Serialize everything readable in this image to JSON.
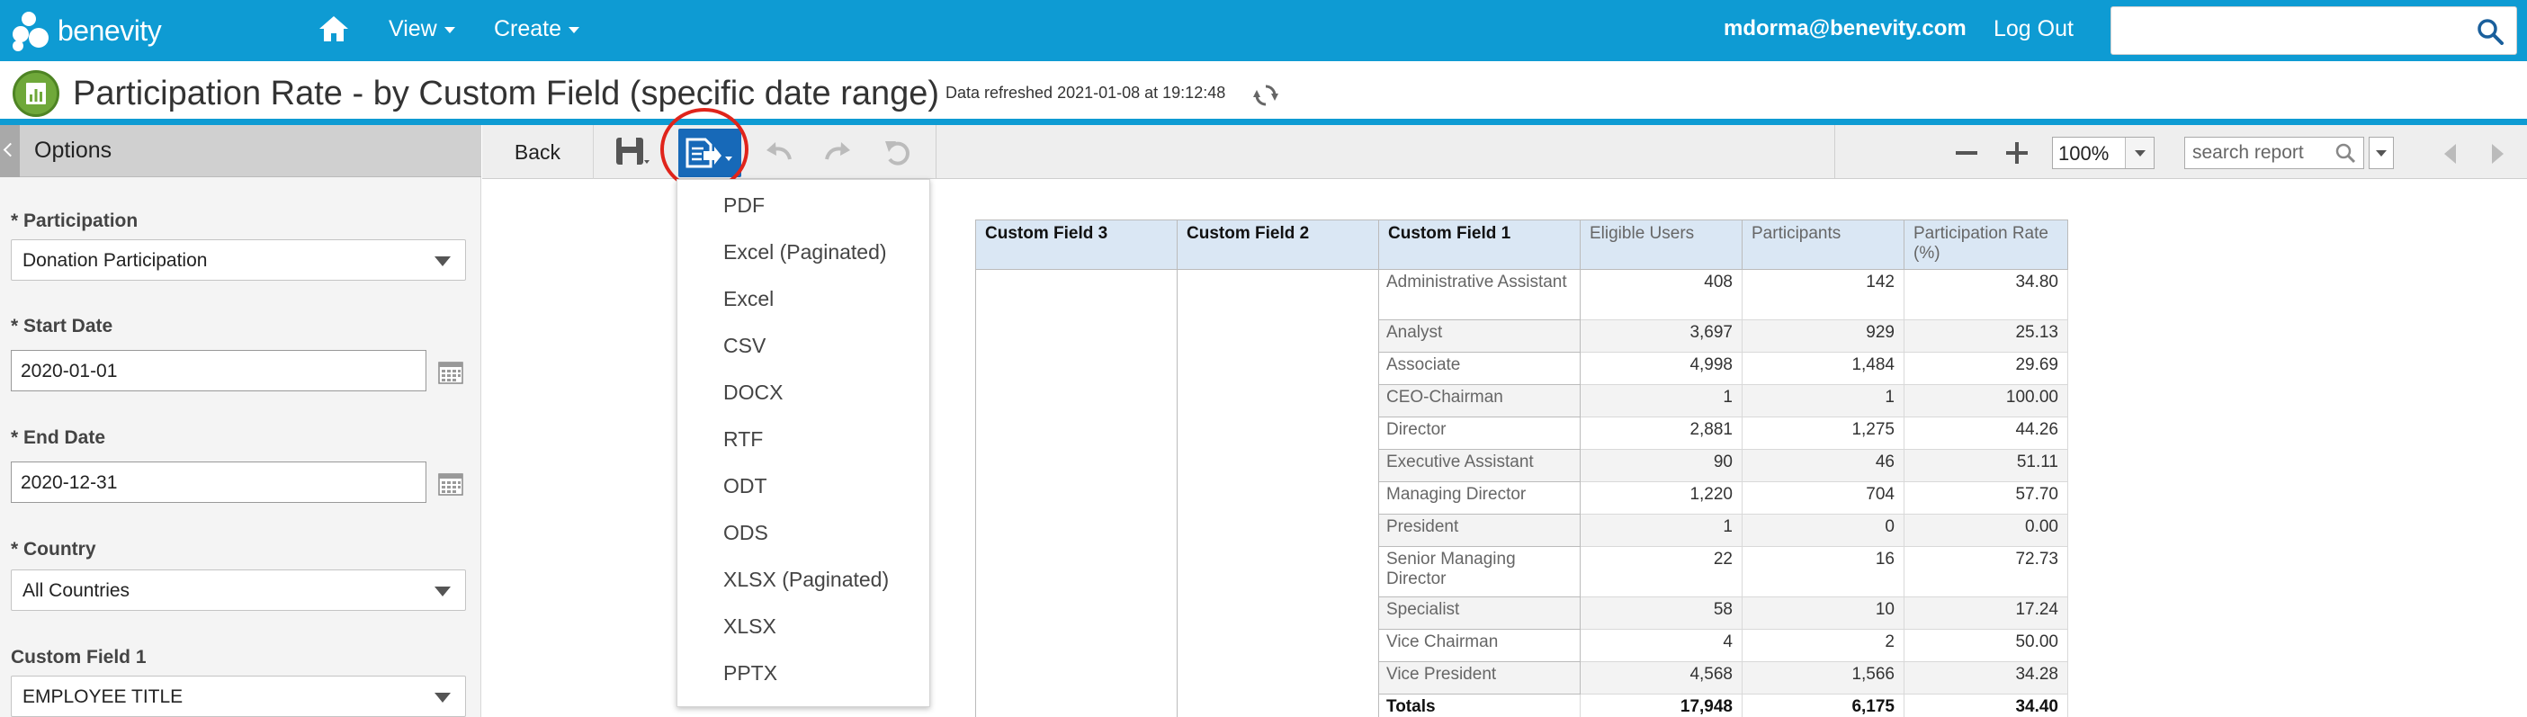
{
  "topbar": {
    "logo_text": "benevity",
    "nav": [
      {
        "label": "View"
      },
      {
        "label": "Create"
      }
    ],
    "user_email": "mdorma@benevity.com",
    "logout_label": "Log Out",
    "search_placeholder": "",
    "colors": {
      "bar": "#0e9bd3"
    }
  },
  "titlebar": {
    "title": "Participation Rate - by Custom Field (specific date range)",
    "refreshed": "Data refreshed 2021-01-08 at 19:12:48"
  },
  "sidebar": {
    "title": "Options",
    "fields": [
      {
        "label": "* Participation",
        "value": "Donation Participation"
      },
      {
        "label": "* Start Date",
        "value": "2020-01-01"
      },
      {
        "label": "* End Date",
        "value": "2020-12-31"
      },
      {
        "label": "* Country",
        "value": "All Countries"
      },
      {
        "label": "Custom Field 1",
        "value": "EMPLOYEE TITLE"
      }
    ]
  },
  "toolbar": {
    "back_label": "Back",
    "zoom": "100%",
    "search_placeholder": "search report"
  },
  "export_menu": {
    "items": [
      "PDF",
      "Excel (Paginated)",
      "Excel",
      "CSV",
      "DOCX",
      "RTF",
      "ODT",
      "ODS",
      "XLSX (Paginated)",
      "XLSX",
      "PPTX"
    ]
  },
  "report": {
    "headers": [
      "Custom Field 3",
      "Custom Field 2",
      "Custom Field 1",
      "Eligible Users",
      "Participants",
      "Participation Rate (%)"
    ],
    "rows": [
      {
        "title": "Administrative Assistant",
        "eligible": "408",
        "participants": "142",
        "rate": "34.80"
      },
      {
        "title": "Analyst",
        "eligible": "3,697",
        "participants": "929",
        "rate": "25.13"
      },
      {
        "title": "Associate",
        "eligible": "4,998",
        "participants": "1,484",
        "rate": "29.69"
      },
      {
        "title": "CEO-Chairman",
        "eligible": "1",
        "participants": "1",
        "rate": "100.00"
      },
      {
        "title": "Director",
        "eligible": "2,881",
        "participants": "1,275",
        "rate": "44.26"
      },
      {
        "title": "Executive Assistant",
        "eligible": "90",
        "participants": "46",
        "rate": "51.11"
      },
      {
        "title": "Managing Director",
        "eligible": "1,220",
        "participants": "704",
        "rate": "57.70"
      },
      {
        "title": "President",
        "eligible": "1",
        "participants": "0",
        "rate": "0.00"
      },
      {
        "title": "Senior Managing Director",
        "eligible": "22",
        "participants": "16",
        "rate": "72.73"
      },
      {
        "title": "Specialist",
        "eligible": "58",
        "participants": "10",
        "rate": "17.24"
      },
      {
        "title": "Vice Chairman",
        "eligible": "4",
        "participants": "2",
        "rate": "50.00"
      },
      {
        "title": "Vice President",
        "eligible": "4,568",
        "participants": "1,566",
        "rate": "34.28"
      }
    ],
    "totals": {
      "label": "Totals",
      "eligible": "17,948",
      "participants": "6,175",
      "rate": "34.40"
    }
  }
}
